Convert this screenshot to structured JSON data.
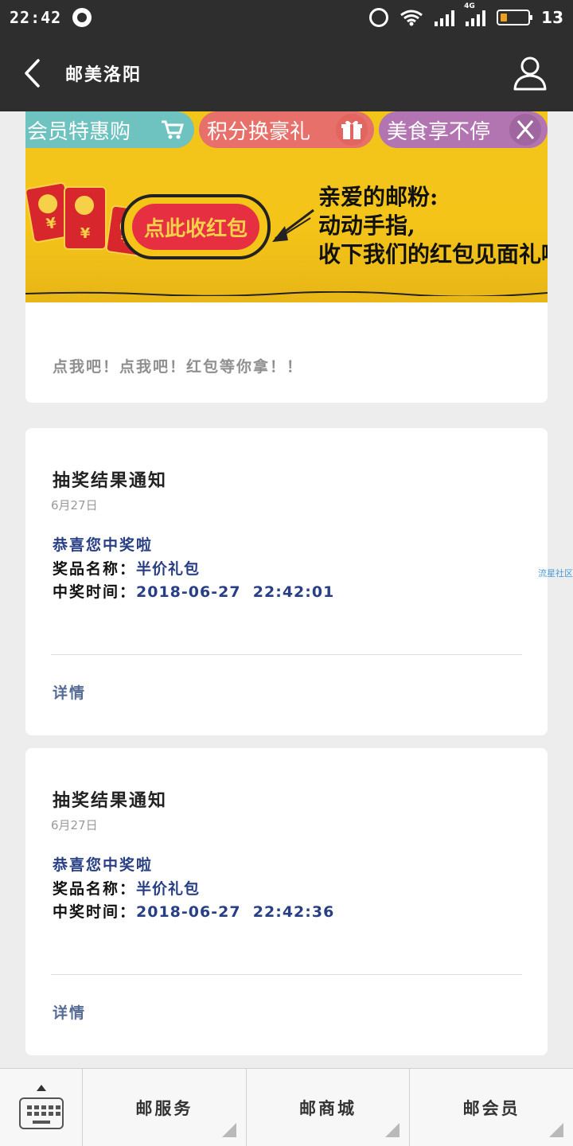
{
  "status_bar": {
    "time": "22:42",
    "battery_level": "13",
    "network": "4G"
  },
  "nav": {
    "title": "邮美洛阳"
  },
  "banner": {
    "tabs": [
      {
        "label": "会员特惠购",
        "icon": "cart-icon"
      },
      {
        "label": "积分换豪礼",
        "icon": "gift-icon"
      },
      {
        "label": "美食享不停",
        "icon": "utensils-icon"
      }
    ],
    "button_label": "点此收红包",
    "message_lines": [
      "亲爱的邮粉:",
      "动动手指,",
      "收下我们的红包见面礼啦"
    ],
    "caption": "点我吧！点我吧！红包等你拿！！"
  },
  "notifications": [
    {
      "title": "抽奖结果通知",
      "date": "6月27日",
      "congrats": "恭喜您中奖啦",
      "prize_label": "奖品名称：",
      "prize_value": "半价礼包",
      "time_label": "中奖时间：",
      "time_value": "2018-06-27  22:42:01",
      "detail": "详情"
    },
    {
      "title": "抽奖结果通知",
      "date": "6月27日",
      "congrats": "恭喜您中奖啦",
      "prize_label": "奖品名称：",
      "prize_value": "半价礼包",
      "time_label": "中奖时间：",
      "time_value": "2018-06-27  22:42:36",
      "detail": "详情"
    }
  ],
  "side_watermark": "流星社区",
  "bottom_menu": {
    "items": [
      "邮服务",
      "邮商城",
      "邮会员"
    ]
  },
  "colors": {
    "nav_bg": "#2e2e2e",
    "page_bg": "#ededed",
    "banner_yellow": "#f2c51b",
    "link_blue": "#283f86"
  }
}
